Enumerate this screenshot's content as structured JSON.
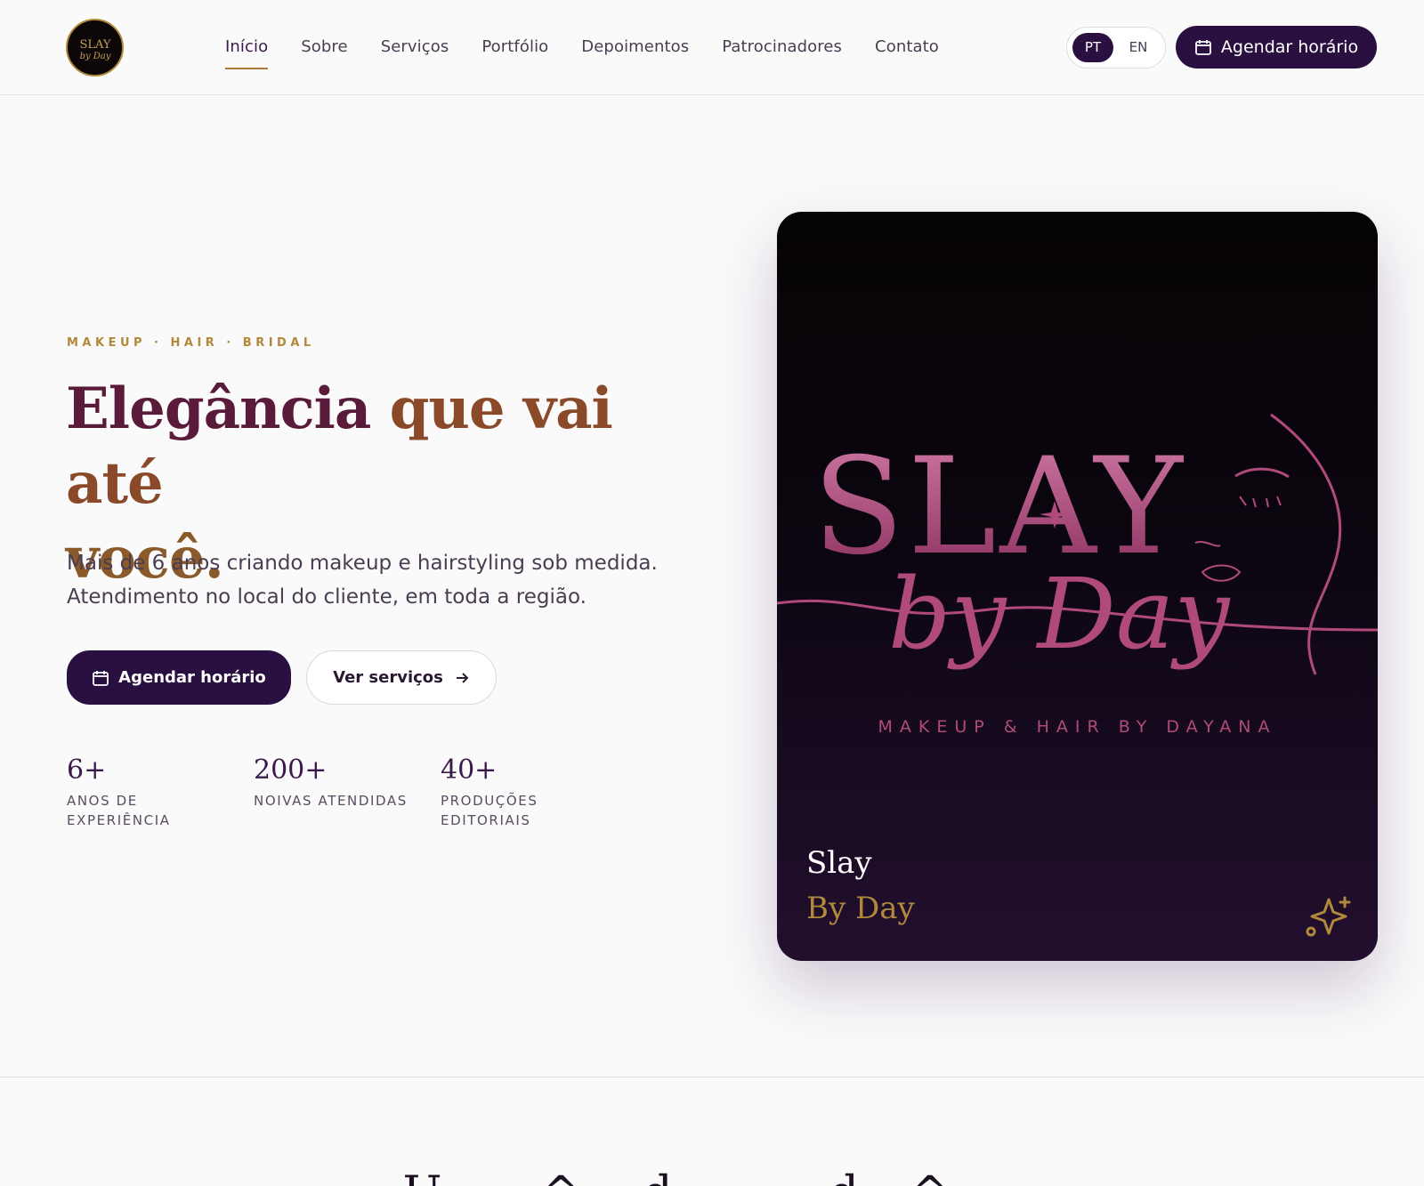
{
  "header": {
    "logo_alt": "Slay by Day",
    "nav": [
      {
        "label": "Início",
        "active": true
      },
      {
        "label": "Sobre"
      },
      {
        "label": "Serviços"
      },
      {
        "label": "Portfólio"
      },
      {
        "label": "Depoimentos"
      },
      {
        "label": "Patrocinadores"
      },
      {
        "label": "Contato"
      }
    ],
    "lang": {
      "pt": "PT",
      "en": "EN",
      "selected": "PT"
    },
    "cta_label": "Agendar horário",
    "cta_icon": "calendar-icon"
  },
  "hero": {
    "eyebrow": "MAKEUP · HAIR · BRIDAL",
    "title_part1": "Elegância ",
    "title_part2": "que vai até",
    "title_part3": "você.",
    "subtitle_line1": "Mais de 6 anos criando makeup e hairstyling sob medida.",
    "subtitle_line2": "Atendimento no local do cliente, em toda a região.",
    "cta_primary": "Agendar horário",
    "cta_secondary": "Ver serviços",
    "stats": [
      {
        "value": "6+",
        "label_line1": "ANOS DE",
        "label_line2": "EXPERIÊNCIA"
      },
      {
        "value": "200+",
        "label_line1": "NOIVAS ATENDIDAS",
        "label_line2": ""
      },
      {
        "value": "40+",
        "label_line1": "PRODUÇÕES",
        "label_line2": "EDITORIAIS"
      }
    ]
  },
  "card": {
    "logo_word": "SLAY",
    "logo_script": "by Day",
    "tagline": "MAKEUP & HAIR BY DAYANA",
    "caption_line1": "Slay",
    "caption_line2": "By Day",
    "icon": "sparkle-icon"
  },
  "colors": {
    "brand": "#2a1040",
    "gold": "#b08a3a",
    "rose": "#b04a7a"
  }
}
